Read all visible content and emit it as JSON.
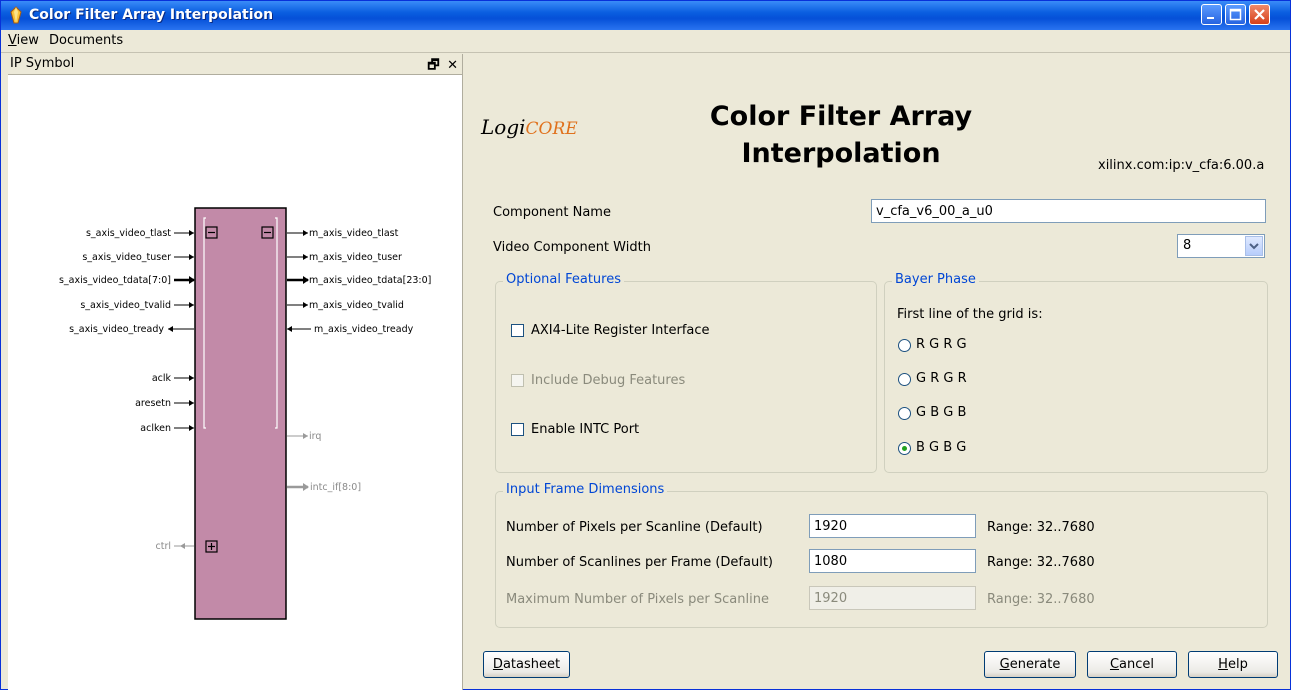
{
  "window": {
    "title": "Color Filter Array Interpolation",
    "icon": "gem-icon"
  },
  "menu": {
    "view_prefix": "V",
    "view_rest": "iew",
    "documents": "Documents"
  },
  "left_panel": {
    "title": "IP Symbol",
    "float_icon": "restore-icon",
    "close_icon": "close-icon",
    "ports_left": [
      "s_axis_video_tlast",
      "s_axis_video_tuser",
      "s_axis_video_tdata[7:0]",
      "s_axis_video_tvalid",
      "s_axis_video_tready",
      "aclk",
      "aresetn",
      "aclken",
      "ctrl"
    ],
    "ports_right": [
      "m_axis_video_tlast",
      "m_axis_video_tuser",
      "m_axis_video_tdata[23:0]",
      "m_axis_video_tvalid",
      "m_axis_video_tready",
      "irq",
      "intc_if[8:0]"
    ],
    "block_color": "#c28aa8"
  },
  "header": {
    "logo": "LogiCORE",
    "logo_prefix": "Logi",
    "logo_suffix": "CORE",
    "title_line1": "Color Filter Array",
    "title_line2": "Interpolation",
    "vlnv": "xilinx.com:ip:v_cfa:6.00.a"
  },
  "form": {
    "component_name_label": "Component Name",
    "component_name_value": "v_cfa_v6_00_a_u0",
    "video_width_label": "Video Component Width",
    "video_width_value": "8"
  },
  "optional_features": {
    "title": "Optional Features",
    "axi4_lite": "AXI4-Lite Register Interface",
    "debug": "Include Debug Features",
    "intc": "Enable INTC Port"
  },
  "bayer_phase": {
    "title": "Bayer Phase",
    "prompt": "First line of the grid is:",
    "options": [
      "R G R G",
      "G R G R",
      "G B G B",
      "B G B G"
    ],
    "selected": "B G B G"
  },
  "frame_dims": {
    "title": "Input Frame Dimensions",
    "pixels_label": "Number of Pixels per Scanline (Default)",
    "pixels_value": "1920",
    "pixels_range": "Range: 32..7680",
    "lines_label": "Number of Scanlines per Frame (Default)",
    "lines_value": "1080",
    "lines_range": "Range: 32..7680",
    "max_label": "Maximum Number of Pixels per Scanline",
    "max_value": "1920",
    "max_range": "Range: 32..7680"
  },
  "buttons": {
    "datasheet_u": "D",
    "datasheet_rest": "atasheet",
    "generate_u": "G",
    "generate_rest": "enerate",
    "cancel_u": "C",
    "cancel_rest": "ancel",
    "help_u": "H",
    "help_rest": "elp"
  }
}
